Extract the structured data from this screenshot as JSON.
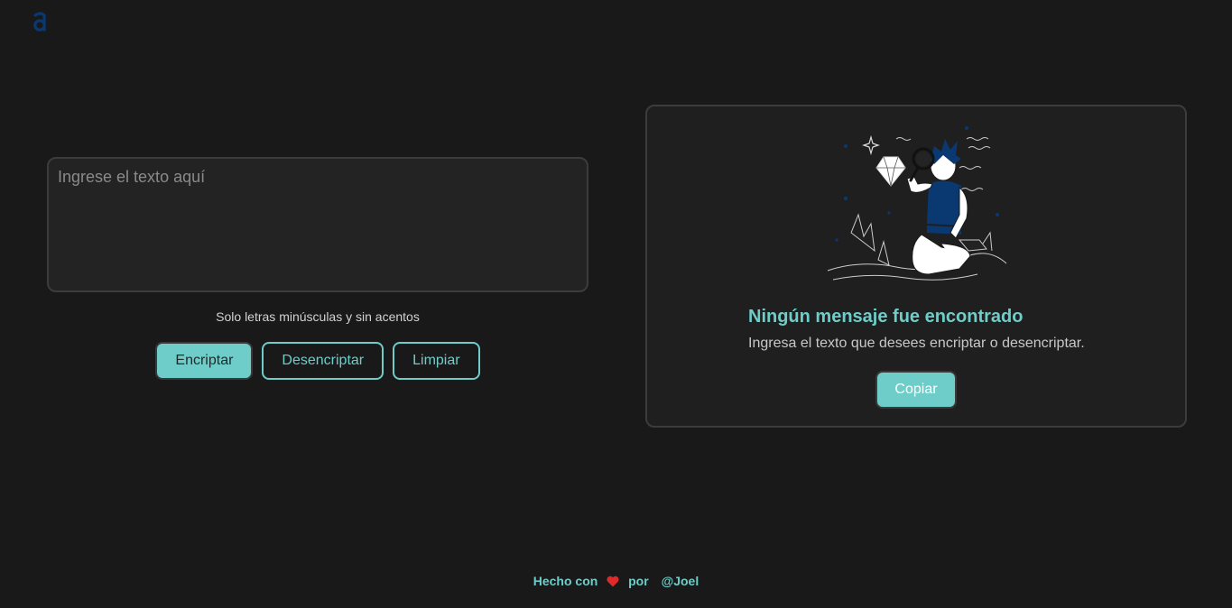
{
  "colors": {
    "background": "#191919",
    "accent": "#6ecdc8",
    "brand_blue": "#0a3871",
    "heart": "#e02a2a"
  },
  "header": {
    "logo_icon": "alura-logo-icon"
  },
  "input": {
    "placeholder": "Ingrese el texto aquí",
    "value": "",
    "hint": "Solo letras minúsculas y sin acentos"
  },
  "actions": {
    "encrypt_label": "Encriptar",
    "decrypt_label": "Desencriptar",
    "clear_label": "Limpiar"
  },
  "output": {
    "illustration_icon": "person-searching-magnifier-illustration",
    "title": "Ningún mensaje fue encontrado",
    "description": "Ingresa el texto que desees encriptar o desencriptar.",
    "copy_label": "Copiar"
  },
  "footer": {
    "made_with": "Hecho con",
    "heart_icon": "heart-icon",
    "by": "por",
    "author": "@Joel"
  }
}
